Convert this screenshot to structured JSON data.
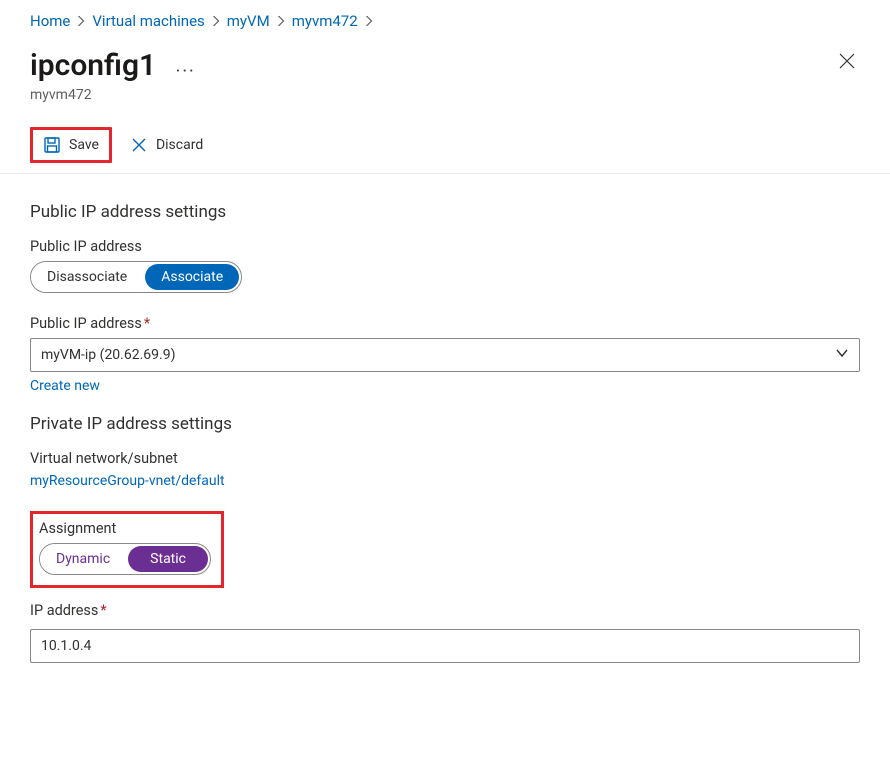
{
  "breadcrumb": {
    "items": [
      {
        "label": "Home"
      },
      {
        "label": "Virtual machines"
      },
      {
        "label": "myVM"
      },
      {
        "label": "myvm472"
      }
    ]
  },
  "header": {
    "title": "ipconfig1",
    "subtitle": "myvm472"
  },
  "toolbar": {
    "save_label": "Save",
    "discard_label": "Discard"
  },
  "public_ip": {
    "section_heading": "Public IP address settings",
    "toggle_label": "Public IP address",
    "options": {
      "disassociate": "Disassociate",
      "associate": "Associate"
    },
    "select_label": "Public IP address",
    "select_value": "myVM-ip (20.62.69.9)",
    "create_new": "Create new"
  },
  "private_ip": {
    "section_heading": "Private IP address settings",
    "vnet_label": "Virtual network/subnet",
    "vnet_value": "myResourceGroup-vnet/default",
    "assignment_label": "Assignment",
    "options": {
      "dynamic": "Dynamic",
      "static": "Static"
    },
    "ip_label": "IP address",
    "ip_value": "10.1.0.4"
  }
}
